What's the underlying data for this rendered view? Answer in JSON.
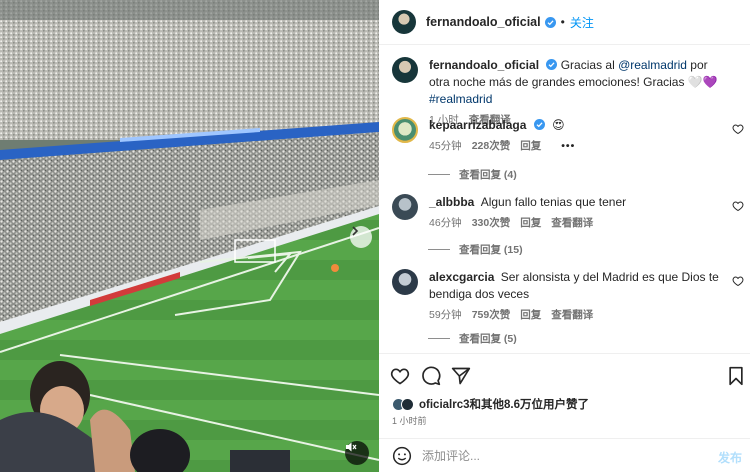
{
  "media": {
    "next_icon": "chevron-right-icon",
    "mute_icon": "speaker-muted-icon"
  },
  "header": {
    "username": "fernandoalo_oficial",
    "separator": "•",
    "follow_label": "关注"
  },
  "caption": {
    "username": "fernandoalo_oficial",
    "text_before": "Gracias al ",
    "mention": "@realmadrid",
    "text_after": " por otra noche más de grandes emociones! Gracias 🤍💜 ",
    "hashtag": "#realmadrid",
    "time": "1 小时",
    "translate": "查看翻译"
  },
  "comments": [
    {
      "username": "kepaarrizabalaga",
      "verified": true,
      "text": "😍",
      "time": "45分钟",
      "likes": "228次赞",
      "reply": "回复",
      "more": "•••",
      "view_replies": "查看回复 (4)"
    },
    {
      "username": "_albbba",
      "verified": false,
      "text": "Algun fallo tenias que tener",
      "time": "46分钟",
      "likes": "330次赞",
      "reply": "回复",
      "translate": "查看翻译",
      "view_replies": "查看回复 (15)"
    },
    {
      "username": "alexcgarcia",
      "verified": false,
      "text": "Ser alonsista y del Madrid es que Dios te bendiga dos veces",
      "time": "59分钟",
      "likes": "759次赞",
      "reply": "回复",
      "translate": "查看翻译",
      "view_replies": "查看回复 (5)"
    }
  ],
  "actions": {
    "likes_text_user": "oficialrc3",
    "likes_text_rest": "和其他8.6万位用户赞了",
    "post_time": "1 小时前",
    "comment_placeholder": "添加评论...",
    "post_label": "发布"
  },
  "colors": {
    "accent_blue": "#0095f6",
    "verified_blue": "#3897f0",
    "mention_blue": "#00376b",
    "muted_text": "#737373"
  }
}
